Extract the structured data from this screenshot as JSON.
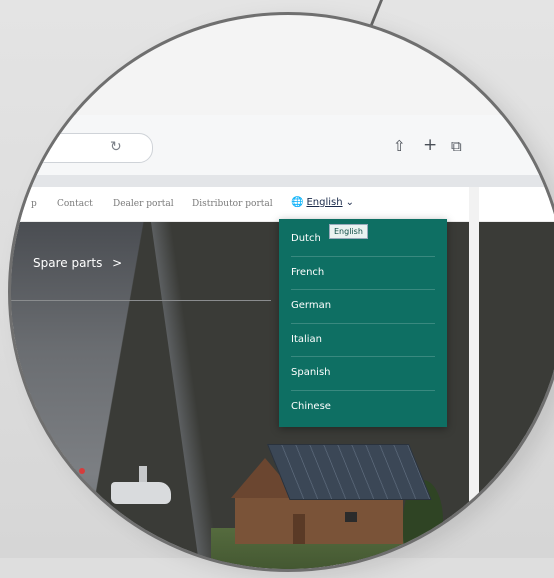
{
  "browser": {
    "reload_icon": "reload-icon",
    "icons": [
      "share-icon",
      "new-tab-icon",
      "tabs-overview-icon"
    ]
  },
  "nav": {
    "links": [
      "p",
      "Contact",
      "Dealer portal",
      "Distributor portal"
    ],
    "language_label": "English",
    "globe_icon": "globe-icon",
    "chevron_icon": "chevron-down-icon"
  },
  "language_menu": {
    "tooltip": "English",
    "options": [
      "Dutch",
      "French",
      "German",
      "Italian",
      "Spanish",
      "Chinese"
    ],
    "background": "#0e6f63"
  },
  "hero": {
    "link_label": "Spare parts",
    "link_arrow": ">"
  }
}
